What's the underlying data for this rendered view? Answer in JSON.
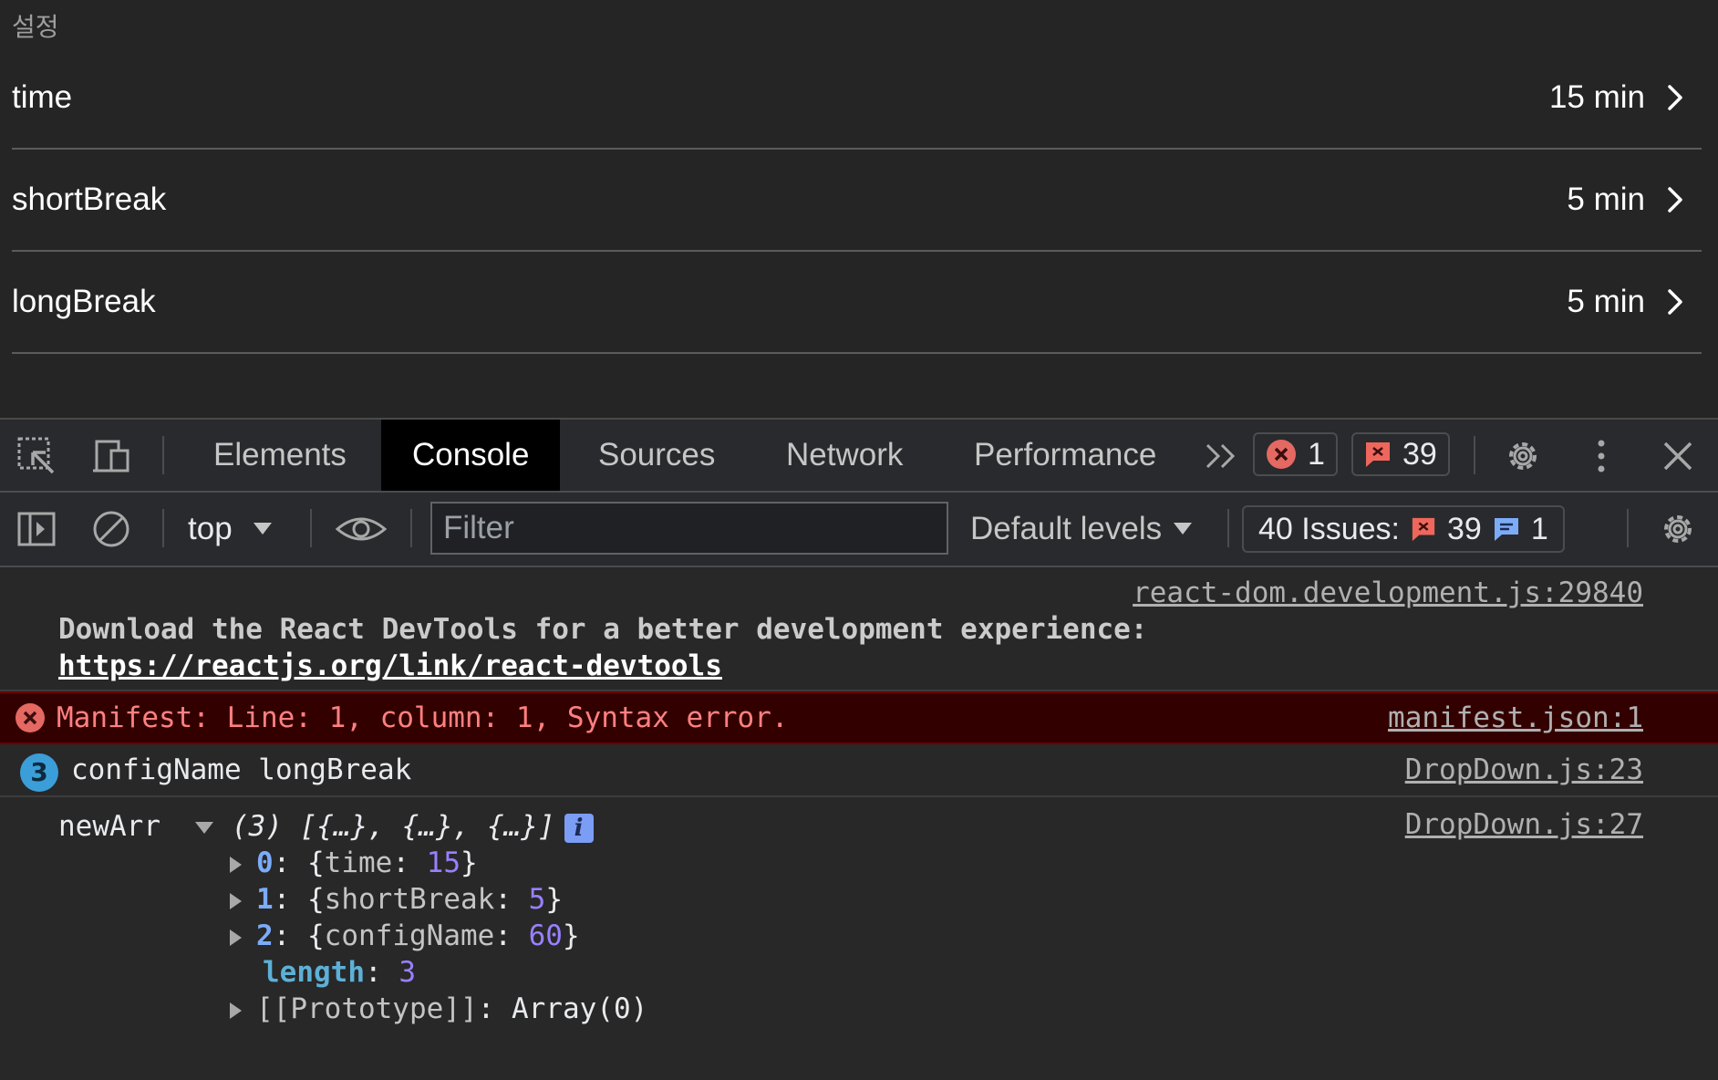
{
  "app": {
    "title": "설정",
    "settings": [
      {
        "name": "time",
        "value": "15 min"
      },
      {
        "name": "shortBreak",
        "value": "5 min"
      },
      {
        "name": "longBreak",
        "value": "5 min"
      }
    ]
  },
  "devtools": {
    "tabs": [
      "Elements",
      "Console",
      "Sources",
      "Network",
      "Performance"
    ],
    "active_tab": "Console",
    "more_tabs_icon": "double-chevron-icon",
    "error_count": "1",
    "warning_count": "39",
    "toolbar": {
      "context": "top",
      "filter_placeholder": "Filter",
      "levels_label": "Default levels",
      "issues_label": "40 Issues:",
      "issues_warning_count": "39",
      "issues_info_count": "1"
    },
    "console": {
      "info_source": "react-dom.development.js:29840",
      "info_text": "Download the React DevTools for a better development experience: ",
      "info_link": "https://reactjs.org/link/react-devtools",
      "error_text": "Manifest: Line: 1, column: 1, Syntax error.",
      "error_source": "manifest.json:1",
      "log_count": "3",
      "log_text": "configName longBreak",
      "log_source": "DropDown.js:23",
      "arr_source": "DropDown.js:27",
      "arr_label": "newArr",
      "arr_summary": "(3) [{…}, {…}, {…}]",
      "arr_items": [
        {
          "index": "0",
          "key": "time",
          "value": "15"
        },
        {
          "index": "1",
          "key": "shortBreak",
          "value": "5"
        },
        {
          "index": "2",
          "key": "configName",
          "value": "60"
        }
      ],
      "length_key": "length",
      "length_value": "3",
      "prototype_key": "[[Prototype]]",
      "prototype_value": "Array(0)"
    },
    "colors": {
      "error": "#ff8080",
      "error_bg": "#330000",
      "number": "#9980ff",
      "key": "#7cacf8",
      "active_tab_bg": "#000000"
    }
  }
}
